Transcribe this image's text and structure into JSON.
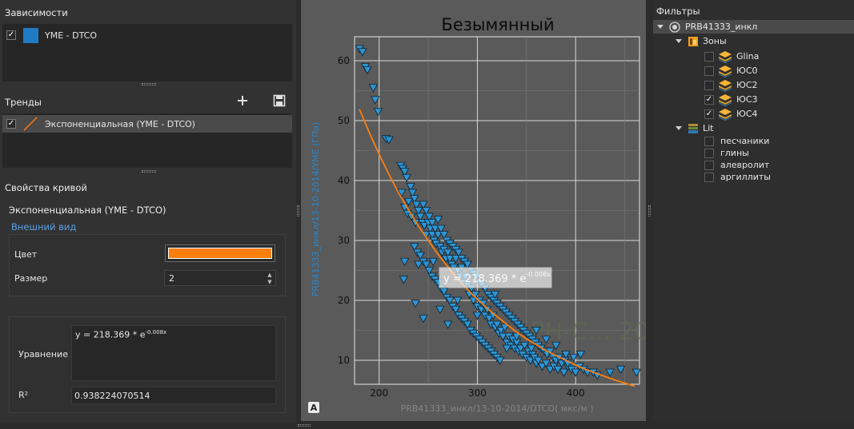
{
  "dependencies": {
    "title": "Зависимости",
    "items": [
      {
        "label": "YME - DTCO",
        "checked": true,
        "color": "#1f7bc4"
      }
    ]
  },
  "trends": {
    "title": "Тренды",
    "add_icon": "plus-icon",
    "save_icon": "save-icon",
    "items": [
      {
        "label": "Экспоненциальная (YME - DTCO)",
        "checked": true,
        "color": "#e8721c"
      }
    ]
  },
  "curve_props": {
    "title": "Свойства кривой",
    "curve_name": "Экспоненциальная (YME - DTCO)",
    "appearance_header": "Внешний вид",
    "color_label": "Цвет",
    "color_value": "#ff7f0e",
    "size_label": "Размер",
    "size_value": "2",
    "equation_label": "Уравнение",
    "equation_value": "y = 218.369 * e",
    "equation_exponent": "-0.008x",
    "r2_label": "R²",
    "r2_value": "0.938224070514"
  },
  "chart": {
    "title": "Безымянный",
    "xlabel": "PRB41333_инкл/13-10-2014/DTCO( мкс/м )",
    "ylabel": "PRB41333_инкл/13-10-2014/YME (ГПа)",
    "watermark": "PH-C... 2018",
    "tooltip_text": "y = 218.369 * e",
    "tooltip_exponent": "-0.008x",
    "corner_button": "A"
  },
  "chart_data": {
    "type": "scatter",
    "title": "Безымянный",
    "xlabel": "PRB41333_инкл/13-10-2014/DTCO( мкс/м )",
    "ylabel": "PRB41333_инкл/13-10-2014/YME (ГПа)",
    "xlim": [
      175,
      465
    ],
    "ylim": [
      6,
      64
    ],
    "xticks": [
      200,
      300,
      400
    ],
    "yticks": [
      10,
      20,
      30,
      40,
      50,
      60
    ],
    "grid": true,
    "legend": "none",
    "series": [
      {
        "marker": "triangle-down",
        "color": "#2e95d3",
        "points": [
          [
            180,
            62
          ],
          [
            183,
            61.5
          ],
          [
            186,
            59
          ],
          [
            188,
            58.5
          ],
          [
            194,
            55.5
          ],
          [
            196,
            53.5
          ],
          [
            199,
            51.5
          ],
          [
            207,
            47
          ],
          [
            210,
            46.8
          ],
          [
            222,
            42.5
          ],
          [
            224,
            42
          ],
          [
            226,
            41.5
          ],
          [
            228,
            40.5
          ],
          [
            223,
            38
          ],
          [
            230,
            36.5
          ],
          [
            232,
            39
          ],
          [
            234,
            38
          ],
          [
            236,
            37
          ],
          [
            238,
            36
          ],
          [
            226,
            35.5
          ],
          [
            229,
            34.5
          ],
          [
            233,
            34
          ],
          [
            237,
            33
          ],
          [
            240,
            35
          ],
          [
            242,
            34
          ],
          [
            244,
            33
          ],
          [
            246,
            32.5
          ],
          [
            248,
            31
          ],
          [
            250,
            33
          ],
          [
            252,
            32
          ],
          [
            254,
            31
          ],
          [
            256,
            30
          ],
          [
            258,
            29.5
          ],
          [
            260,
            31
          ],
          [
            262,
            29
          ],
          [
            264,
            28
          ],
          [
            266,
            28.5
          ],
          [
            268,
            27
          ],
          [
            270,
            28
          ],
          [
            272,
            27
          ],
          [
            274,
            26
          ],
          [
            276,
            25.5
          ],
          [
            278,
            27
          ],
          [
            280,
            25
          ],
          [
            282,
            24
          ],
          [
            284,
            25.5
          ],
          [
            286,
            23
          ],
          [
            288,
            24
          ],
          [
            290,
            22.5
          ],
          [
            292,
            21
          ],
          [
            294,
            22
          ],
          [
            296,
            20
          ],
          [
            298,
            21
          ],
          [
            300,
            19
          ],
          [
            302,
            20
          ],
          [
            304,
            18.5
          ],
          [
            306,
            19.5
          ],
          [
            308,
            17.5
          ],
          [
            310,
            18.5
          ],
          [
            312,
            17
          ],
          [
            314,
            16
          ],
          [
            316,
            17.5
          ],
          [
            318,
            15.5
          ],
          [
            320,
            16
          ],
          [
            322,
            14.5
          ],
          [
            324,
            15
          ],
          [
            326,
            14
          ],
          [
            328,
            15.5
          ],
          [
            330,
            13
          ],
          [
            332,
            14
          ],
          [
            334,
            12.5
          ],
          [
            336,
            13.5
          ],
          [
            338,
            12
          ],
          [
            340,
            13
          ],
          [
            342,
            11.5
          ],
          [
            344,
            12
          ],
          [
            346,
            11
          ],
          [
            348,
            12.5
          ],
          [
            350,
            10.5
          ],
          [
            352,
            11.5
          ],
          [
            354,
            10
          ],
          [
            356,
            11
          ],
          [
            358,
            10.5
          ],
          [
            360,
            9.5
          ],
          [
            362,
            10
          ],
          [
            366,
            9
          ],
          [
            370,
            9.5
          ],
          [
            374,
            8.5
          ],
          [
            378,
            9
          ],
          [
            382,
            8.5
          ],
          [
            388,
            8
          ],
          [
            392,
            9
          ],
          [
            396,
            8.5
          ],
          [
            400,
            8
          ],
          [
            404,
            9
          ],
          [
            408,
            8.5
          ],
          [
            412,
            8
          ],
          [
            418,
            8
          ],
          [
            422,
            7.5
          ],
          [
            435,
            8
          ],
          [
            446,
            8.5
          ],
          [
            462,
            8
          ],
          [
            245,
            36
          ],
          [
            248,
            35
          ],
          [
            251,
            34
          ],
          [
            254,
            33
          ],
          [
            257,
            32
          ],
          [
            260,
            33.5
          ],
          [
            263,
            32
          ],
          [
            266,
            31
          ],
          [
            269,
            30
          ],
          [
            272,
            29.5
          ],
          [
            275,
            29
          ],
          [
            278,
            28.5
          ],
          [
            281,
            28
          ],
          [
            284,
            27
          ],
          [
            287,
            26.5
          ],
          [
            290,
            26
          ],
          [
            293,
            25
          ],
          [
            296,
            24.5
          ],
          [
            299,
            24
          ],
          [
            302,
            23
          ],
          [
            305,
            22.5
          ],
          [
            308,
            22
          ],
          [
            311,
            21
          ],
          [
            314,
            20.5
          ],
          [
            317,
            20
          ],
          [
            320,
            19.5
          ],
          [
            323,
            19
          ],
          [
            326,
            18.5
          ],
          [
            329,
            18
          ],
          [
            332,
            17.5
          ],
          [
            335,
            17
          ],
          [
            338,
            16.5
          ],
          [
            341,
            16
          ],
          [
            344,
            15.5
          ],
          [
            347,
            15
          ],
          [
            350,
            14.5
          ],
          [
            353,
            14
          ],
          [
            356,
            13.5
          ],
          [
            359,
            13
          ],
          [
            362,
            12.5
          ],
          [
            365,
            12
          ],
          [
            368,
            11.5
          ],
          [
            371,
            11
          ],
          [
            374,
            11.5
          ],
          [
            377,
            10.5
          ],
          [
            380,
            10
          ],
          [
            383,
            10.5
          ],
          [
            386,
            9.5
          ],
          [
            389,
            10
          ],
          [
            392,
            9.5
          ],
          [
            236,
            29
          ],
          [
            239,
            28
          ],
          [
            242,
            27.5
          ],
          [
            245,
            26.5
          ],
          [
            248,
            26
          ],
          [
            251,
            25
          ],
          [
            254,
            24
          ],
          [
            257,
            23.5
          ],
          [
            260,
            23
          ],
          [
            263,
            22
          ],
          [
            266,
            21.5
          ],
          [
            269,
            20.5
          ],
          [
            272,
            20
          ],
          [
            275,
            19
          ],
          [
            278,
            18.5
          ],
          [
            281,
            17.5
          ],
          [
            284,
            17
          ],
          [
            287,
            16.5
          ],
          [
            290,
            16
          ],
          [
            293,
            15
          ],
          [
            296,
            14.5
          ],
          [
            299,
            14
          ],
          [
            302,
            13.5
          ],
          [
            305,
            13
          ],
          [
            308,
            12.5
          ],
          [
            311,
            12
          ],
          [
            314,
            11.5
          ],
          [
            317,
            11
          ],
          [
            320,
            10.5
          ],
          [
            323,
            10
          ],
          [
            225,
            23.5
          ],
          [
            226,
            26.5
          ],
          [
            240,
            26
          ],
          [
            255,
            26.5
          ],
          [
            237,
            19.5
          ],
          [
            245,
            17
          ],
          [
            262,
            18.5
          ],
          [
            270,
            16
          ],
          [
            280,
            20
          ],
          [
            300,
            17.5
          ],
          [
            318,
            21
          ],
          [
            330,
            12
          ],
          [
            340,
            14
          ],
          [
            355,
            12
          ],
          [
            360,
            15
          ],
          [
            370,
            13.5
          ],
          [
            380,
            12.5
          ],
          [
            390,
            11
          ],
          [
            398,
            10.5
          ],
          [
            405,
            11
          ]
        ]
      },
      {
        "name": "Экспоненциальная (YME - DTCO)",
        "type": "line",
        "color": "#ff7f0e",
        "equation": "y = 218.369 * e^(-0.008x)",
        "x": [
          180,
          190,
          200,
          210,
          220,
          230,
          240,
          250,
          260,
          270,
          280,
          290,
          300,
          310,
          320,
          330,
          340,
          350,
          360,
          370,
          380,
          390,
          400,
          410,
          420,
          430,
          440,
          450,
          460
        ],
        "y": [
          51.9,
          48.0,
          44.4,
          41.0,
          37.9,
          35.1,
          32.4,
          30.0,
          27.7,
          25.6,
          23.6,
          21.8,
          20.2,
          18.7,
          17.3,
          16.0,
          14.7,
          13.6,
          12.6,
          11.6,
          10.8,
          10.0,
          9.2,
          8.5,
          7.9,
          7.3,
          6.7,
          6.2,
          5.7
        ]
      }
    ]
  },
  "filters": {
    "title": "Фильтры",
    "root": "PRB41333_инкл",
    "zones_label": "Зоны",
    "zones": [
      {
        "label": "Glina",
        "checked": false
      },
      {
        "label": "ЮС0",
        "checked": false
      },
      {
        "label": "ЮС2",
        "checked": false
      },
      {
        "label": "ЮС3",
        "checked": true
      },
      {
        "label": "ЮС4",
        "checked": true
      }
    ],
    "lit_label": "Lit",
    "lit": [
      {
        "label": "песчаники",
        "checked": false
      },
      {
        "label": "глины",
        "checked": false
      },
      {
        "label": "алевролит",
        "checked": false
      },
      {
        "label": "аргиллиты",
        "checked": false
      }
    ]
  }
}
